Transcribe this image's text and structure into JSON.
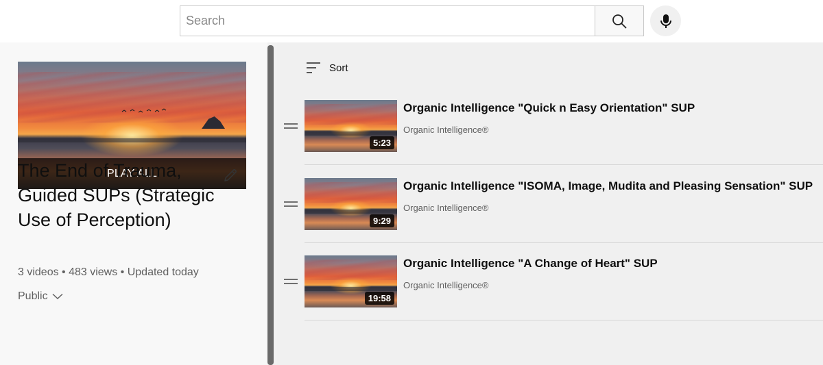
{
  "search": {
    "placeholder": "Search"
  },
  "playlist": {
    "play_all_label": "PLAY ALL",
    "title": "The End of Trauma, Guided SUPs (Strategic Use of Perception)",
    "meta": "3 videos • 483 views • Updated today",
    "privacy": "Public"
  },
  "sort": {
    "label": "Sort"
  },
  "videos": [
    {
      "title": "Organic Intelligence \"Quick n Easy Orientation\" SUP",
      "channel": "Organic Intelligence®",
      "duration": "5:23"
    },
    {
      "title": "Organic Intelligence \"ISOMA, Image, Mudita and Pleasing Sensation\" SUP",
      "channel": "Organic Intelligence®",
      "duration": "9:29"
    },
    {
      "title": "Organic Intelligence \"A Change of Heart\" SUP",
      "channel": "Organic Intelligence®",
      "duration": "19:58"
    }
  ],
  "icons": {
    "search": "search-icon",
    "mic": "microphone-icon",
    "edit": "pencil-icon",
    "privacy_toggle": "chevron-down-icon",
    "sort": "sort-icon",
    "drag": "drag-handle-icon"
  }
}
